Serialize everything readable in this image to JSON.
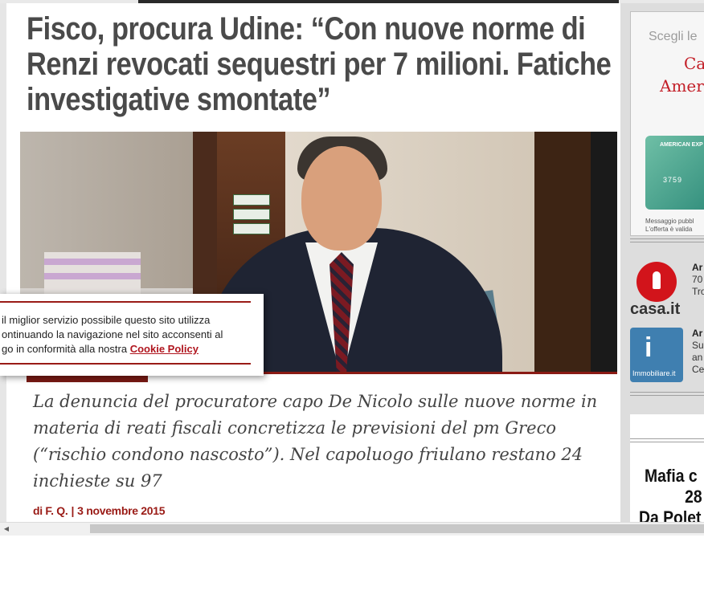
{
  "article": {
    "headline": "Fisco, procura Udine: “Con nuove norme di Renzi revocati sequestri per 7 milioni. Fatiche investigative smontate”",
    "summary": "La denuncia del procuratore capo De Nicolo sulle nuove norme in materia di reati fiscali concretizza le previsioni del pm Greco (“rischio condono nascosto”). Nel capoluogo friulano restano 24 inchieste su 97",
    "author": "di F. Q.",
    "separator": "|",
    "date": "3 novembre 2015"
  },
  "cookie_banner": {
    "text": "il miglior servizio possibile questo sito utilizza ontinuando la navigazione nel sito acconsenti al go in conformità alla nostra",
    "line1": "il miglior servizio possibile questo sito utilizza",
    "line2": "ontinuando la navigazione nel sito acconsenti al",
    "line3": "go in conformità alla nostra",
    "link": "Cookie Policy"
  },
  "sidebar": {
    "ad": {
      "line1": "Scegli le",
      "line2": "Ca",
      "line3": "Amer",
      "card_brand": "AMERICAN EXP",
      "card_number": "3759",
      "fine1": "Messaggio pubbl",
      "fine2": "L'offerta è valida"
    },
    "casa": {
      "logo_text": "casa.it",
      "lines": [
        "Ar",
        "70",
        "Tro"
      ]
    },
    "immobiliare": {
      "logo_text": "Immobiliare.it",
      "lines": [
        "Ar",
        "Su",
        "an",
        "Ce"
      ]
    },
    "promo": {
      "line1": "Mafia c",
      "line2": "28",
      "line3": "Da Polet"
    }
  },
  "colors": {
    "accent": "#9a1b16",
    "headline": "#4a4a4a",
    "sidebar_bg": "#dddddd"
  }
}
